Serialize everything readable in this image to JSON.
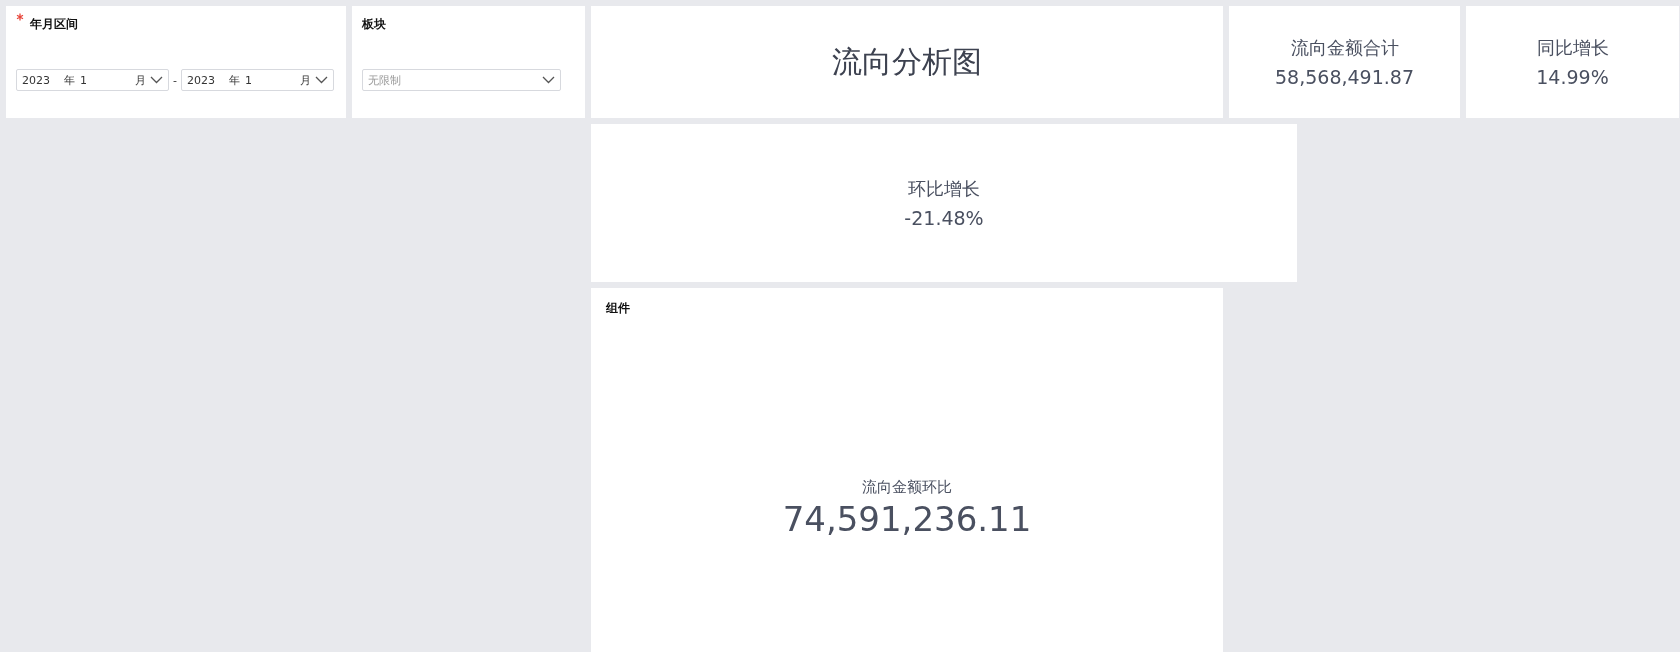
{
  "date_range": {
    "label": "年月区间",
    "required": true,
    "start": {
      "year": "2023",
      "year_unit": "年",
      "month": "1",
      "month_unit": "月"
    },
    "separator": "-",
    "end": {
      "year": "2023",
      "year_unit": "年",
      "month": "1",
      "month_unit": "月"
    }
  },
  "sector": {
    "label": "板块",
    "placeholder": "无限制"
  },
  "title_card": {
    "title": "流向分析图"
  },
  "total_card": {
    "label": "流向金额合计",
    "value": "58,568,491.87"
  },
  "yoy_card": {
    "label": "同比增长",
    "value": "14.99%"
  },
  "mom_card": {
    "label": "环比增长",
    "value": "-21.48%"
  },
  "component_card": {
    "title": "组件",
    "label": "流向金额环比",
    "value": "74,591,236.11"
  }
}
